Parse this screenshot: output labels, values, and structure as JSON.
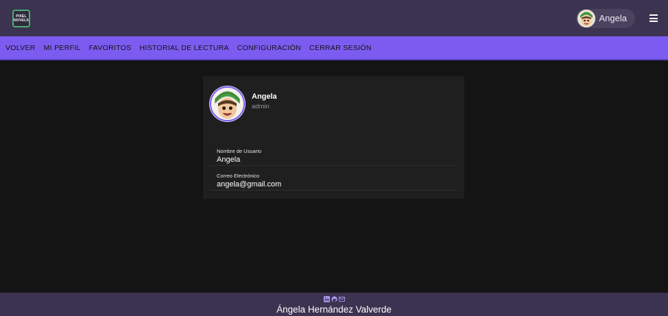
{
  "header": {
    "logo_text": "PIXEL NOVELS",
    "user_name": "Angela"
  },
  "nav": {
    "items": [
      "VOLVER",
      "MI PERFIL",
      "FAVORITOS",
      "HISTORIAL DE LECTURA",
      "CONFIGURACIÓN",
      "CERRAR SESIÓN"
    ]
  },
  "profile": {
    "name": "Angela",
    "role": "admin",
    "fields": [
      {
        "label": "Nombre de Usuario",
        "value": "Angela"
      },
      {
        "label": "Correo Electrónico",
        "value": "angela@gmail.com"
      }
    ]
  },
  "footer": {
    "author": "Ángela Hernández Valverde",
    "icons": [
      "linkedin-icon",
      "github-icon",
      "mail-icon"
    ]
  },
  "colors": {
    "header_bg": "#3b3350",
    "accent": "#7c5cf0",
    "page_bg": "#141414",
    "card_bg": "#1f1f1f"
  }
}
